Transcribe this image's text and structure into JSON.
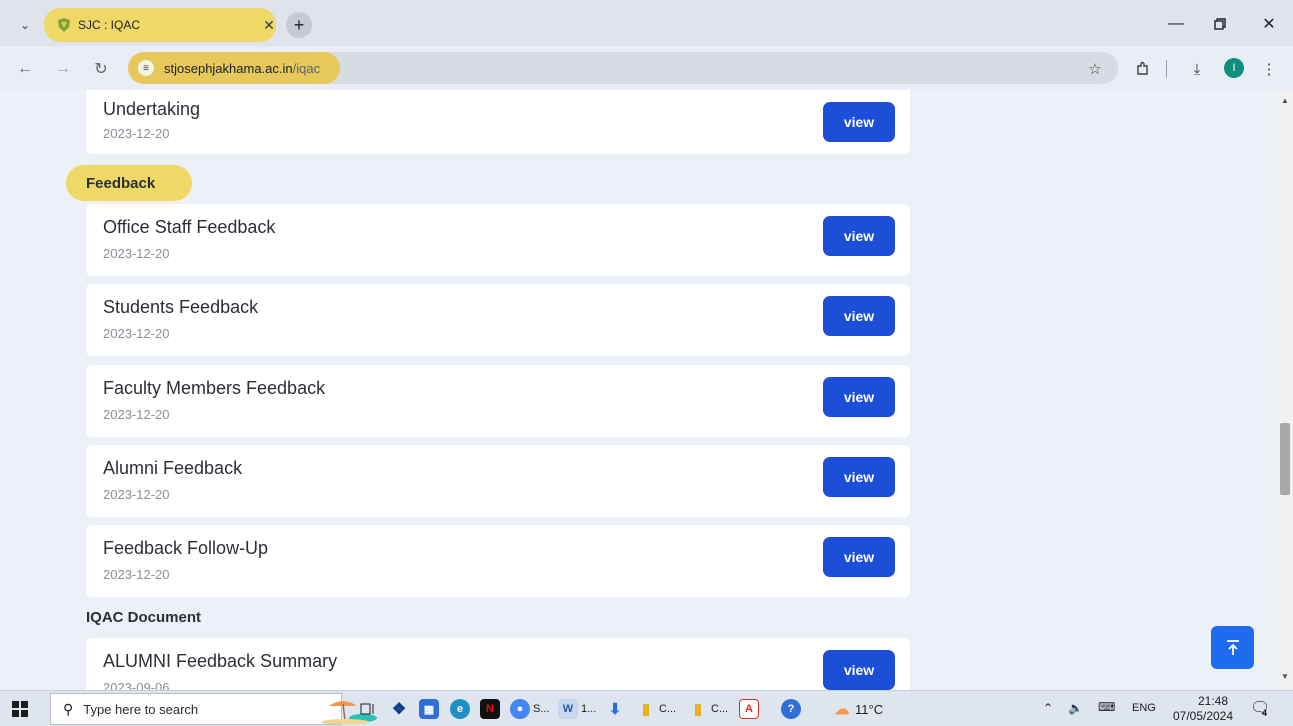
{
  "browser": {
    "tab_title": "SJC : IQAC",
    "url_host": "stjosephjakhama.ac.in",
    "url_path": "/iqac",
    "profile_initial": "I"
  },
  "page": {
    "view_label": "view",
    "items_top": [
      {
        "title": "Undertaking",
        "date": "2023-12-20"
      }
    ],
    "section_feedback": "Feedback",
    "feedback_items": [
      {
        "title": "Office Staff Feedback",
        "date": "2023-12-20"
      },
      {
        "title": "Students Feedback",
        "date": "2023-12-20"
      },
      {
        "title": "Faculty Members Feedback",
        "date": "2023-12-20"
      },
      {
        "title": "Alumni Feedback",
        "date": "2023-12-20"
      },
      {
        "title": "Feedback Follow-Up",
        "date": "2023-12-20"
      }
    ],
    "section_iqac": "IQAC Document",
    "iqac_items": [
      {
        "title": "ALUMNI Feedback Summary",
        "date": "2023-09-06"
      }
    ]
  },
  "taskbar": {
    "search_placeholder": "Type here to search",
    "apps": [
      {
        "name": "chrome-s",
        "label": "S..."
      },
      {
        "name": "word-1",
        "label": "1..."
      },
      {
        "name": "folder-c1",
        "label": "C..."
      },
      {
        "name": "folder-c2",
        "label": "C..."
      }
    ],
    "weather": "11°C",
    "language": "ENG",
    "time": "21:48",
    "date": "07/05/2024",
    "notification_count": "4"
  },
  "colors": {
    "accent_yellow": "#f0d867",
    "button_blue": "#1d4ed8",
    "scroll_top_blue": "#1e6bf0"
  }
}
